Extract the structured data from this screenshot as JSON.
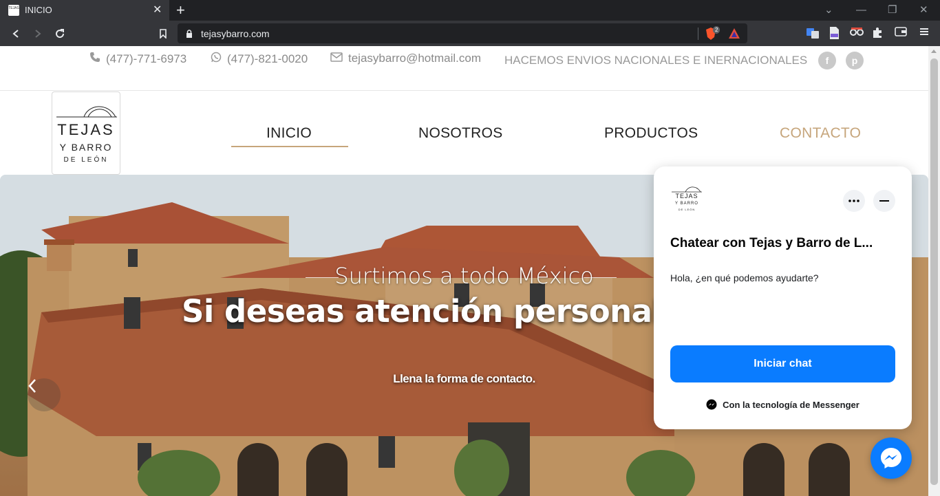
{
  "browser": {
    "tab_title": "INICIO",
    "favicon_text": "TEJAS",
    "url": "tejasybarro.com",
    "shield_count": "2"
  },
  "topbar": {
    "phone": "(477)-771-6973",
    "whatsapp": "(477)-821-0020",
    "email": "tejasybarro@hotmail.com",
    "shipping_notice": "HACEMOS ENVIOS NACIONALES E INERNACIONALES",
    "social": [
      "f",
      "p"
    ]
  },
  "logo": {
    "line1": "TEJAS",
    "line2": "Y BARRO",
    "line3": "DE LEÓN"
  },
  "nav": {
    "items": [
      {
        "label": "INICIO",
        "color": "#222222"
      },
      {
        "label": "NOSOTROS",
        "color": "#222222"
      },
      {
        "label": "PRODUCTOS",
        "color": "#222222"
      },
      {
        "label": "CONTACTO",
        "color": "#c6a57b"
      }
    ],
    "active_underline_color": "#c6a57b"
  },
  "hero": {
    "subtitle": "Surtimos a todo México",
    "title": "Si deseas atención personaliza",
    "description": "Llena la forma de contacto."
  },
  "chat": {
    "title": "Chatear con Tejas y Barro de L...",
    "message": "Hola, ¿en qué podemos ayudarte?",
    "start_button": "Iniciar chat",
    "powered_by": "Con la tecnología de Messenger",
    "button_color": "#0a7cff"
  }
}
